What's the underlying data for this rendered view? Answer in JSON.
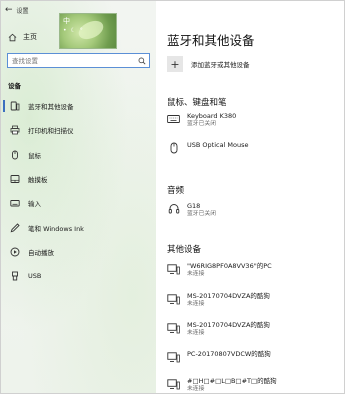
{
  "window": {
    "title": "设置",
    "back_glyph": "←"
  },
  "thumbnail": {
    "ime_text": "中",
    "dots_text": "• ☾ °"
  },
  "sidebar": {
    "home_label": "主页",
    "search": {
      "placeholder": "查找设置",
      "value": ""
    },
    "section_label": "设备",
    "items": [
      {
        "label": "蓝牙和其他设备",
        "icon": "bluetooth-devices-icon",
        "active": true
      },
      {
        "label": "打印机和扫描仪",
        "icon": "printer-icon",
        "active": false
      },
      {
        "label": "鼠标",
        "icon": "mouse-icon",
        "active": false
      },
      {
        "label": "触摸板",
        "icon": "touchpad-icon",
        "active": false
      },
      {
        "label": "输入",
        "icon": "keyboard-icon",
        "active": false
      },
      {
        "label": "笔和 Windows Ink",
        "icon": "pen-icon",
        "active": false
      },
      {
        "label": "自动播放",
        "icon": "autoplay-icon",
        "active": false
      },
      {
        "label": "USB",
        "icon": "usb-icon",
        "active": false
      }
    ]
  },
  "main": {
    "title": "蓝牙和其他设备",
    "add_button_label": "添加蓝牙或其他设备",
    "groups": [
      {
        "title": "鼠标、键盘和笔",
        "devices": [
          {
            "name": "Keyboard K380",
            "status": "蓝牙已关闭",
            "icon": "keyboard-icon"
          },
          {
            "name": "USB Optical Mouse",
            "status": "",
            "icon": "mouse-icon"
          }
        ]
      },
      {
        "title": "音频",
        "devices": [
          {
            "name": "G18",
            "status": "蓝牙已关闭",
            "icon": "headset-icon"
          }
        ]
      },
      {
        "title": "其他设备",
        "devices": [
          {
            "name": "\"W6RIG8PF0A8VV36\"的PC",
            "status": "未连接",
            "icon": "computer-icon"
          },
          {
            "name": "MS-20170704DVZA的酷狗",
            "status": "未连接",
            "icon": "computer-icon"
          },
          {
            "name": "MS-20170704DVZA的酷狗",
            "status": "未连接",
            "icon": "computer-icon"
          },
          {
            "name": "PC-20170807VDCW的酷狗",
            "status": "",
            "icon": "computer-icon"
          },
          {
            "name": "#□H□#□L□B□#T□的酷狗",
            "status": "未连接",
            "icon": "computer-icon"
          }
        ]
      }
    ]
  },
  "colors": {
    "accent": "#3c6fbf",
    "search_border": "#5b8fd6",
    "sidebar_bg": "#eef2ee",
    "content_bg": "#ffffff"
  }
}
